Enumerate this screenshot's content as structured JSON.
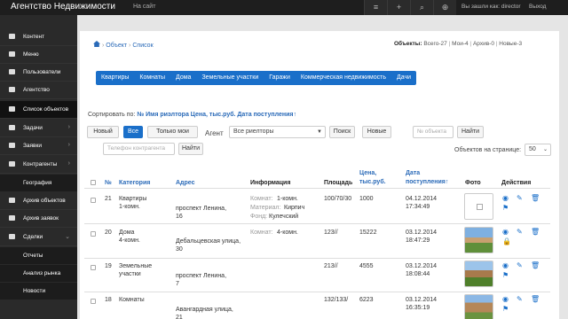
{
  "topbar": {
    "brand": "Агентство Недвижимости",
    "site_link": "На сайт",
    "user": "Вы зашли как: director",
    "logout": "Выход"
  },
  "sidebar": {
    "items": [
      {
        "label": "Контент",
        "icon": "edit-icon"
      },
      {
        "label": "Меню",
        "icon": "user-icon"
      },
      {
        "label": "Пользователи",
        "icon": "users-icon"
      },
      {
        "label": "Агентство",
        "icon": "list-icon"
      },
      {
        "label": "Список объектов",
        "icon": "list-icon"
      },
      {
        "label": "Задачи",
        "icon": "briefcase-icon"
      },
      {
        "label": "Заявки",
        "icon": "comment-icon"
      },
      {
        "label": "Контрагенты",
        "icon": "users-icon"
      },
      {
        "label": "География",
        "icon": ""
      },
      {
        "label": "Архив объектов",
        "icon": "list-icon"
      },
      {
        "label": "Архив заявок",
        "icon": "comment-icon"
      },
      {
        "label": "Сделки",
        "icon": "list-icon"
      },
      {
        "label": "Отчеты",
        "icon": ""
      },
      {
        "label": "Анализ рынка",
        "icon": ""
      },
      {
        "label": "Новости",
        "icon": ""
      }
    ]
  },
  "breadcrumb": {
    "b1": "Объект",
    "b2": "Список",
    "sep": "›"
  },
  "counts": {
    "label": "Объекты:",
    "total": "Всего-27",
    "mine": "Мои-4",
    "archive": "Архив-0",
    "new": "Новые-3"
  },
  "tabs": [
    "Квартиры",
    "Комнаты",
    "Дома",
    "Земельные участки",
    "Гаражи",
    "Коммерческая недвижимость",
    "Дачи"
  ],
  "sort": {
    "label": "Сортировать по:",
    "options": "№ Имя риэлтора Цена, тыс.руб. Дата поступления↑"
  },
  "filters": {
    "new_btn": "Новый",
    "all_btn": "Все",
    "mine_btn": "Только мои",
    "agent_label": "Агент",
    "agent_value": "Все риелторы",
    "search_btn": "Поиск",
    "new2_btn": "Новые",
    "obj_placeholder": "№ объекта",
    "find_btn": "Найти",
    "phone_placeholder": "Телефон контрагента",
    "find2_btn": "Найти",
    "perpage_label": "Объектов на странице:",
    "perpage_value": "50"
  },
  "table": {
    "headers": {
      "num": "№",
      "category": "Категория",
      "address": "Адрес",
      "info": "Информация",
      "area": "Площадь",
      "price1": "Цена,",
      "price2": "тыс.руб.",
      "date1": "Дата",
      "date2": "поступления↑",
      "photo": "Фото",
      "actions": "Действия"
    },
    "rows": [
      {
        "num": "21",
        "cat1": "Квартиры",
        "cat2": "1-комн.",
        "addr1": "проспект Ленина,",
        "addr2": "16",
        "i1k": "Комнат:",
        "i1v": "1-комн.",
        "i2k": "Материал:",
        "i2v": "Кирпич",
        "i3k": "Фонд:",
        "i3v": "Кулечский",
        "area": "100/70/30",
        "price": "1000",
        "date": "04.12.2014",
        "time": "17:34:49"
      },
      {
        "num": "20",
        "cat1": "Дома",
        "cat2": "4-комн.",
        "addr1": "Дебальцевская улица,",
        "addr2": "30",
        "i1k": "Комнат:",
        "i1v": "4-комн.",
        "i2k": "",
        "i2v": "",
        "i3k": "",
        "i3v": "",
        "area": "123//",
        "price": "15222",
        "date": "03.12.2014",
        "time": "18:47:29"
      },
      {
        "num": "19",
        "cat1": "Земельные",
        "cat2": "участки",
        "addr1": "проспект Ленина,",
        "addr2": "7",
        "i1k": "",
        "i1v": "",
        "i2k": "",
        "i2v": "",
        "i3k": "",
        "i3v": "",
        "area": "213//",
        "price": "4555",
        "date": "03.12.2014",
        "time": "18:08:44"
      },
      {
        "num": "18",
        "cat1": "Комнаты",
        "cat2": "",
        "addr1": "Авангардная улица,",
        "addr2": "21",
        "i1k": "",
        "i1v": "",
        "i2k": "",
        "i2v": "",
        "i3k": "",
        "i3v": "",
        "area": "132/133/",
        "price": "6223",
        "date": "03.12.2014",
        "time": "16:35:19"
      }
    ]
  }
}
